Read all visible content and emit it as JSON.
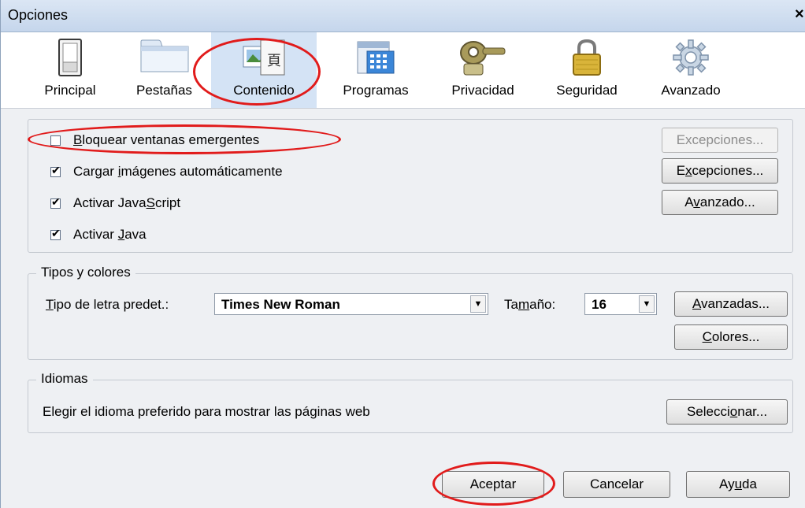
{
  "window": {
    "title": "Opciones",
    "close_glyph": "×"
  },
  "tabs": [
    {
      "label": "Principal",
      "icon": "switch-icon",
      "selected": false
    },
    {
      "label": "Pestañas",
      "icon": "folder-tab-icon",
      "selected": false
    },
    {
      "label": "Contenido",
      "icon": "content-page-icon",
      "selected": true
    },
    {
      "label": "Programas",
      "icon": "calendar-app-icon",
      "selected": false
    },
    {
      "label": "Privacidad",
      "icon": "mask-icon",
      "selected": false
    },
    {
      "label": "Seguridad",
      "icon": "padlock-icon",
      "selected": false
    },
    {
      "label": "Avanzado",
      "icon": "gear-icon",
      "selected": false
    }
  ],
  "content": {
    "popup": {
      "pre": "",
      "mnemonic": "B",
      "post": "loquear ventanas emergentes",
      "checked": false
    },
    "images": {
      "pre": "Cargar ",
      "mnemonic": "i",
      "post": "mágenes automáticamente",
      "checked": true
    },
    "javascript": {
      "pre": "Activar Java",
      "mnemonic": "S",
      "post": "cript",
      "checked": true
    },
    "java": {
      "pre": "Activar ",
      "mnemonic": "J",
      "post": "ava",
      "checked": true
    },
    "btn_popup_exceptions": {
      "pre": "Excepciones...",
      "mnemonic": "",
      "post": "",
      "enabled": false
    },
    "btn_images_exceptions": {
      "pre": "E",
      "mnemonic": "x",
      "post": "cepciones...",
      "enabled": true
    },
    "btn_js_advanced": {
      "pre": "A",
      "mnemonic": "v",
      "post": "anzado...",
      "enabled": true
    }
  },
  "fonts": {
    "legend": "Tipos y colores",
    "font_label": {
      "pre": "",
      "mnemonic": "T",
      "post": "ipo de letra predet.:"
    },
    "font_value": "Times New Roman",
    "size_label": {
      "pre": "Ta",
      "mnemonic": "m",
      "post": "año:"
    },
    "size_value": "16",
    "btn_advanced": {
      "pre": "",
      "mnemonic": "A",
      "post": "vanzadas..."
    },
    "btn_colors": {
      "pre": "",
      "mnemonic": "C",
      "post": "olores..."
    }
  },
  "languages": {
    "legend": "Idiomas",
    "description": "Elegir el idioma preferido para mostrar las páginas web",
    "btn_select": {
      "pre": "Selecci",
      "mnemonic": "o",
      "post": "nar..."
    }
  },
  "footer": {
    "accept": "Aceptar",
    "cancel": "Cancelar",
    "help": {
      "pre": "Ay",
      "mnemonic": "u",
      "post": "da"
    }
  },
  "annotation_color": "#e11b1b"
}
